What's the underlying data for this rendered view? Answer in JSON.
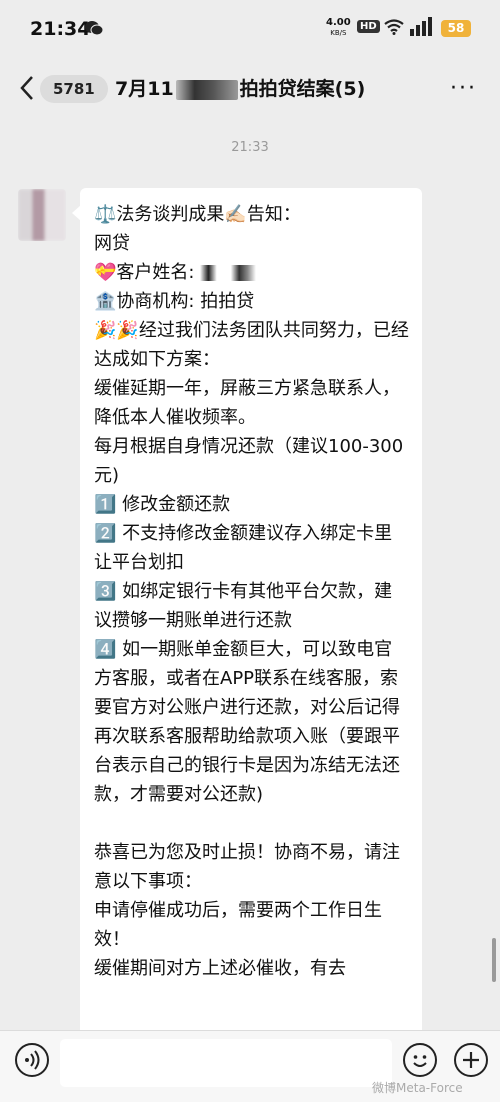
{
  "status_bar": {
    "time": "21:34",
    "net_speed": "4.00",
    "net_speed_unit": "KB/S",
    "hd_label": "HD",
    "battery": "58"
  },
  "nav": {
    "unread_count": "5781",
    "title_prefix": "7月11",
    "title_suffix": "拍拍贷结案(5)"
  },
  "chat": {
    "timestamp": "21:33",
    "message": {
      "line1": "⚖️法务谈判成果✍🏻告知：\n网贷\n💝客户姓名: ",
      "line2": "\n🏦协商机构: 拍拍贷\n🎉🎉经过我们法务团队共同努力，已经达成如下方案：\n缓催延期一年，屏蔽三方紧急联系人，降低本人催收频率。\n每月根据自身情况还款（建议100-300元)\n1️⃣ 修改金额还款\n2️⃣ 不支持修改金额建议存入绑定卡里让平台划扣\n3️⃣ 如绑定银行卡有其他平台欠款，建议攒够一期账单进行还款\n4️⃣ 如一期账单金额巨大，可以致电官方客服，或者在APP联系在线客服，索要官方对公账户进行还款，对公后记得再次联系客服帮助给款项入账（要跟平台表示自己的银行卡是因为冻结无法还款，才需要对公还款)\n\n恭喜已为您及时止损！协商不易，请注意以下事项：\n申请停催成功后，需要两个工作日生效！\n缓催期间对方上述必催收，有去"
    }
  },
  "footer": {
    "watermark": "微博Meta-Force"
  },
  "icons": {
    "back": "back-chevron-icon",
    "more": "more-dots-icon",
    "voice": "voice-icon",
    "emoji": "emoji-icon",
    "plus": "plus-icon",
    "wifi": "wifi-icon",
    "signal": "signal-icon"
  },
  "colors": {
    "background": "#ededed",
    "bubble": "#ffffff",
    "battery": "#f0b23a"
  }
}
